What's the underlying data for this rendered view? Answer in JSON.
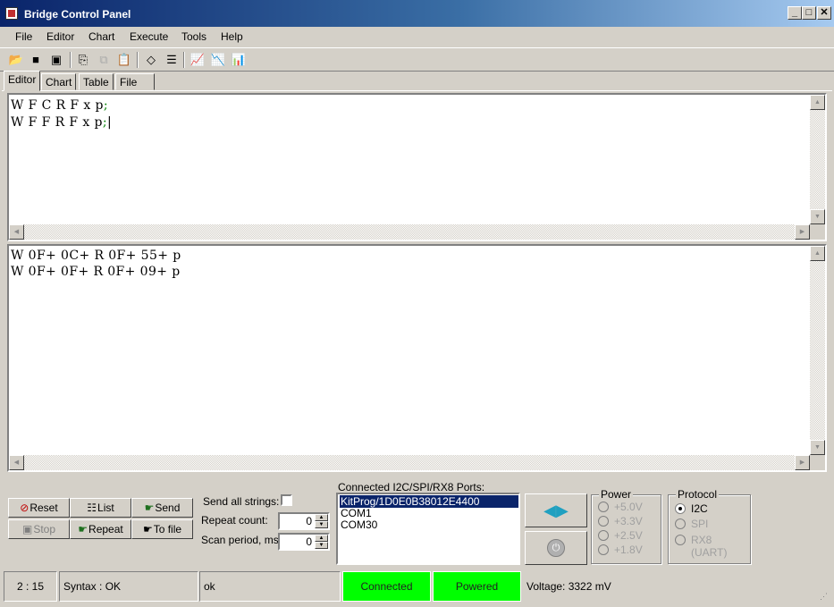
{
  "window": {
    "title": "Bridge Control Panel"
  },
  "window_buttons": {
    "minimize": "_",
    "maximize": "□",
    "close": "✕"
  },
  "menu": [
    "File",
    "Editor",
    "Chart",
    "Execute",
    "Tools",
    "Help"
  ],
  "toolbar": [
    "open-icon",
    "save-icon",
    "save-all-icon",
    "copy-file-icon",
    "copy-icon",
    "paste-icon",
    "eraser-icon",
    "list-icon",
    "chart-icon",
    "chart2-icon",
    "chart3-icon"
  ],
  "tabs": [
    "Editor",
    "Chart",
    "Table",
    "File"
  ],
  "editor": {
    "lines": [
      {
        "text": "W F C R F x p",
        "end": ";"
      },
      {
        "text": "W F F R F x p",
        "end": ";"
      }
    ]
  },
  "output": {
    "lines": [
      "W 0F+ 0C+ R 0F+ 55+ p",
      "W 0F+ 0F+ R 0F+ 09+ p"
    ]
  },
  "buttons": {
    "reset": "Reset",
    "list": "List",
    "send": "Send",
    "stop": "Stop",
    "repeat": "Repeat",
    "to_file": "To file"
  },
  "options": {
    "send_all_strings": "Send all strings:",
    "repeat_count_label": "Repeat count:",
    "repeat_count": "0",
    "scan_period_label": "Scan period, ms:",
    "scan_period": "0"
  },
  "ports": {
    "label": "Connected I2C/SPI/RX8 Ports:",
    "items": [
      "KitProg/1D0E0B38012E4400",
      "COM1",
      "COM30"
    ],
    "selected": 0
  },
  "power": {
    "title": "Power",
    "options": [
      "+5.0V",
      "+3.3V",
      "+2.5V",
      "+1.8V"
    ]
  },
  "protocol": {
    "title": "Protocol",
    "options": [
      "I2C",
      "SPI",
      "RX8 (UART)"
    ],
    "selected": 0
  },
  "status": {
    "cursor": "2 : 15",
    "syntax": "Syntax : OK",
    "message": "ok",
    "connected": "Connected",
    "powered": "Powered",
    "voltage": "Voltage: 3322 mV"
  },
  "colors": {
    "status_green": "#00ff00",
    "selection": "#0a246a",
    "title_gradient_start": "#0a246a"
  }
}
